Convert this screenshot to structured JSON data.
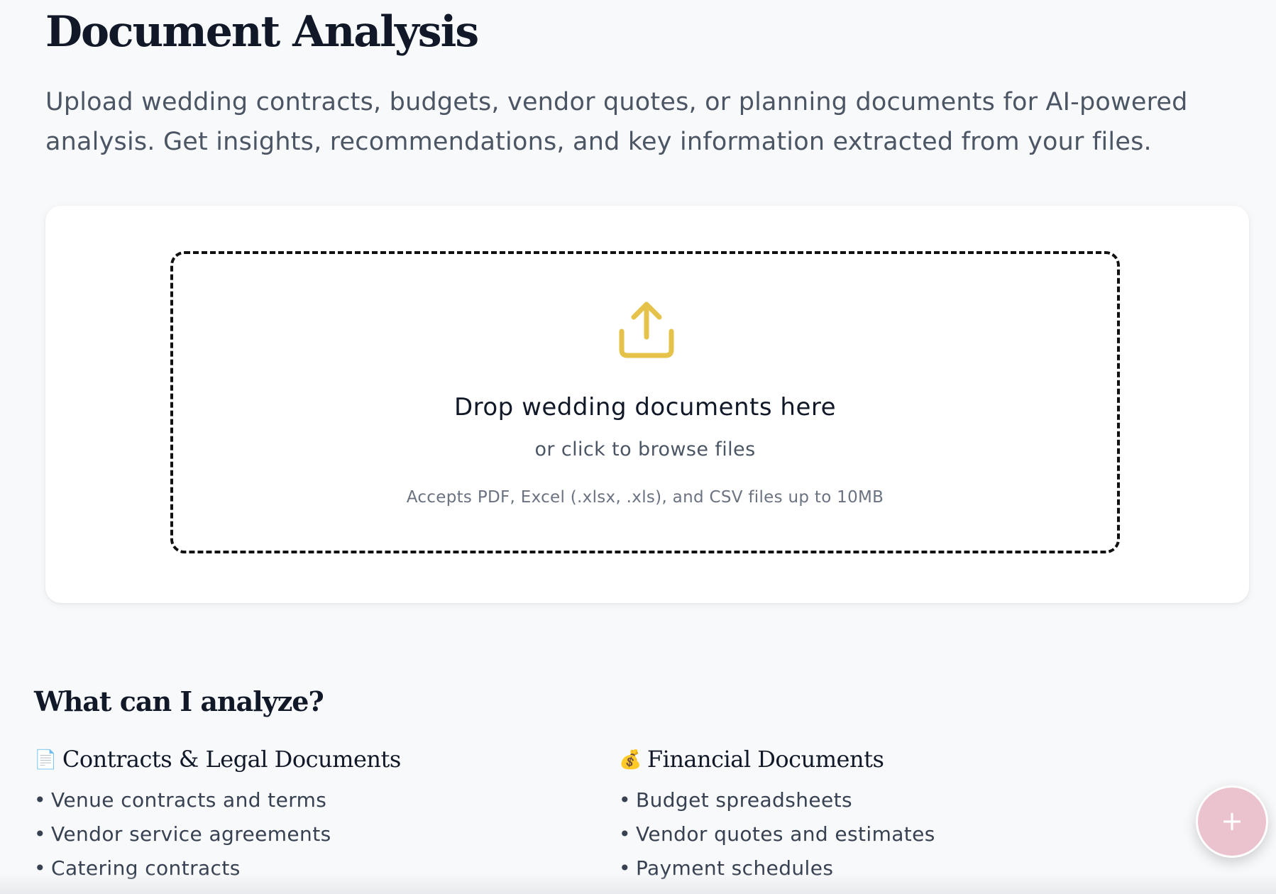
{
  "page": {
    "title": "Document Analysis",
    "subtitle": "Upload wedding contracts, budgets, vendor quotes, or planning documents for AI-powered analysis. Get insights, recommendations, and key information extracted from your files."
  },
  "upload": {
    "icon": "upload-icon",
    "title": "Drop wedding documents here",
    "subtitle": "or click to browse files",
    "hint": "Accepts PDF, Excel (.xlsx, .xls), and CSV files up to 10MB"
  },
  "analyze": {
    "title": "What can I analyze?",
    "categories": [
      {
        "emoji": "📄",
        "title": "Contracts & Legal Documents",
        "items": [
          "Venue contracts and terms",
          "Vendor service agreements",
          "Catering contracts"
        ]
      },
      {
        "emoji": "💰",
        "title": "Financial Documents",
        "items": [
          "Budget spreadsheets",
          "Vendor quotes and estimates",
          "Payment schedules"
        ]
      }
    ]
  },
  "fab": {
    "label": "+",
    "icon": "plus-icon"
  },
  "colors": {
    "accent": "#e5c24a",
    "fab": "#ebc3cf",
    "background": "#f8f9fb"
  }
}
